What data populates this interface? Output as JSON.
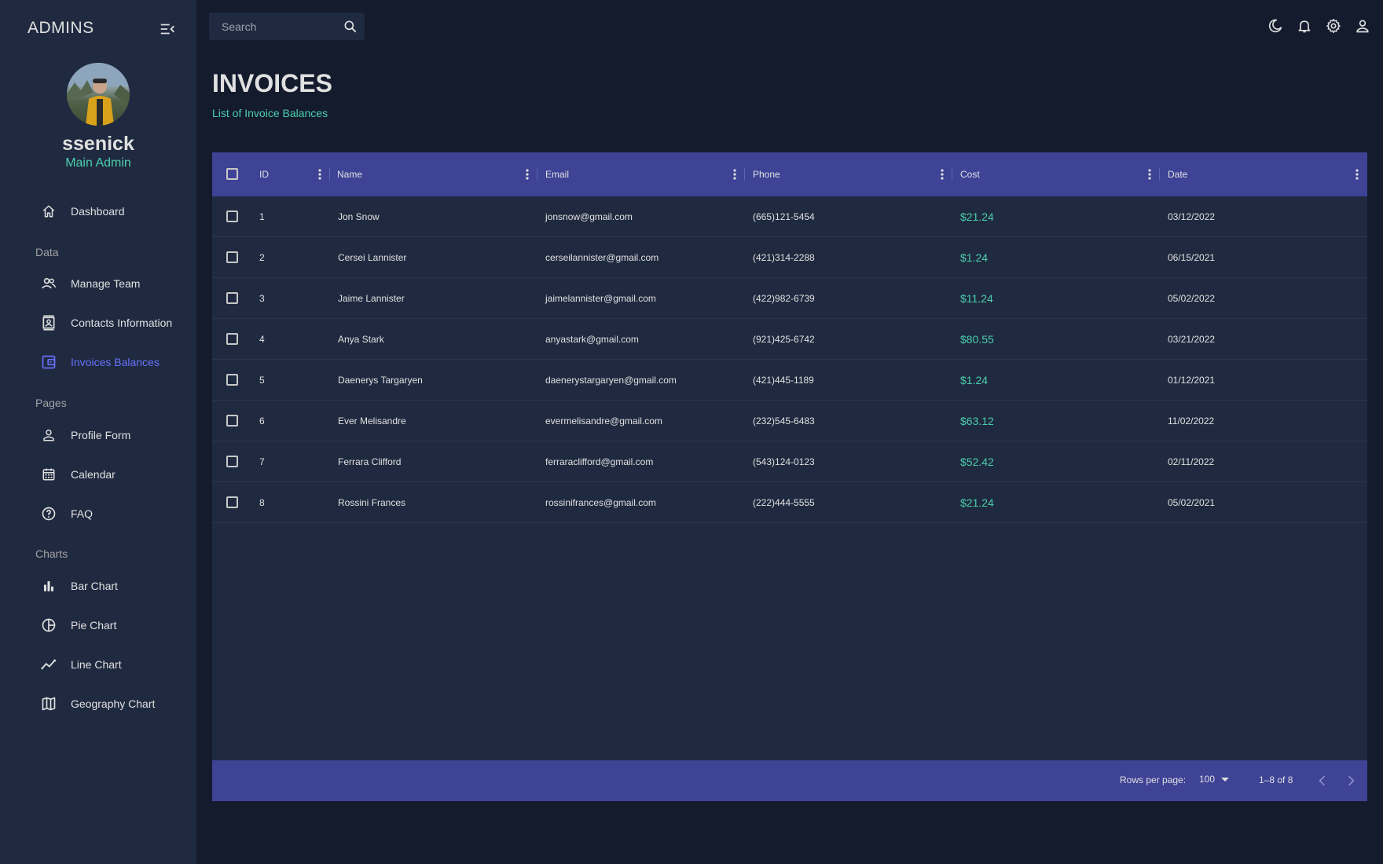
{
  "sidebar": {
    "brand": "ADMINS",
    "user": {
      "name": "ssenick",
      "role": "Main Admin"
    },
    "items": [
      {
        "label": "Dashboard",
        "icon": "home-icon"
      },
      {
        "section": "Data"
      },
      {
        "label": "Manage Team",
        "icon": "people-icon"
      },
      {
        "label": "Contacts Information",
        "icon": "contacts-icon"
      },
      {
        "label": "Invoices Balances",
        "icon": "receipt-icon",
        "active": true
      },
      {
        "section": "Pages"
      },
      {
        "label": "Profile Form",
        "icon": "person-icon"
      },
      {
        "label": "Calendar",
        "icon": "calendar-icon"
      },
      {
        "label": "FAQ",
        "icon": "help-icon"
      },
      {
        "section": "Charts"
      },
      {
        "label": "Bar Chart",
        "icon": "bar-chart-icon"
      },
      {
        "label": "Pie Chart",
        "icon": "pie-chart-icon"
      },
      {
        "label": "Line Chart",
        "icon": "timeline-icon"
      },
      {
        "label": "Geography Chart",
        "icon": "map-icon"
      }
    ],
    "sections": {
      "data": "Data",
      "pages": "Pages",
      "charts": "Charts"
    }
  },
  "topbar": {
    "search_placeholder": "Search",
    "icons": [
      "dark-mode-icon",
      "notifications-icon",
      "settings-icon",
      "person-icon"
    ]
  },
  "header": {
    "title": "INVOICES",
    "subtitle": "List of Invoice Balances"
  },
  "table": {
    "columns": [
      "ID",
      "Name",
      "Email",
      "Phone",
      "Cost",
      "Date"
    ],
    "rows": [
      {
        "id": "1",
        "name": "Jon Snow",
        "email": "jonsnow@gmail.com",
        "phone": "(665)121-5454",
        "cost": "$21.24",
        "date": "03/12/2022"
      },
      {
        "id": "2",
        "name": "Cersei Lannister",
        "email": "cerseilannister@gmail.com",
        "phone": "(421)314-2288",
        "cost": "$1.24",
        "date": "06/15/2021"
      },
      {
        "id": "3",
        "name": "Jaime Lannister",
        "email": "jaimelannister@gmail.com",
        "phone": "(422)982-6739",
        "cost": "$11.24",
        "date": "05/02/2022"
      },
      {
        "id": "4",
        "name": "Anya Stark",
        "email": "anyastark@gmail.com",
        "phone": "(921)425-6742",
        "cost": "$80.55",
        "date": "03/21/2022"
      },
      {
        "id": "5",
        "name": "Daenerys Targaryen",
        "email": "daenerystargaryen@gmail.com",
        "phone": "(421)445-1189",
        "cost": "$1.24",
        "date": "01/12/2021"
      },
      {
        "id": "6",
        "name": "Ever Melisandre",
        "email": "evermelisandre@gmail.com",
        "phone": "(232)545-6483",
        "cost": "$63.12",
        "date": "11/02/2022"
      },
      {
        "id": "7",
        "name": "Ferrara Clifford",
        "email": "ferraraclifford@gmail.com",
        "phone": "(543)124-0123",
        "cost": "$52.42",
        "date": "02/11/2022"
      },
      {
        "id": "8",
        "name": "Rossini Frances",
        "email": "rossinifrances@gmail.com",
        "phone": "(222)444-5555",
        "cost": "$21.24",
        "date": "05/02/2021"
      }
    ],
    "footer": {
      "rows_per_page_label": "Rows per page:",
      "rows_per_page_value": "100",
      "range": "1–8 of 8"
    }
  },
  "colors": {
    "background": "#141b2d",
    "panel": "#1f2a40",
    "header_bar": "#3e4396",
    "accent_green": "#4cceac",
    "accent_blue": "#6870fa"
  }
}
